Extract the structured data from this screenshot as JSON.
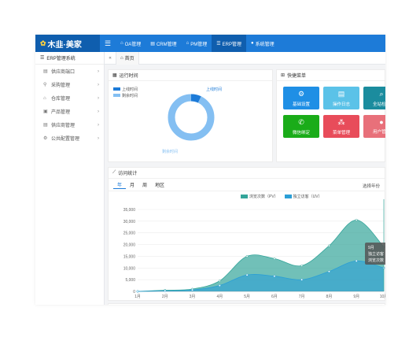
{
  "app": {
    "brand": "木韭·美家",
    "brand_mark": "✿"
  },
  "topnav": {
    "toggle_icon": "menu-icon",
    "items": [
      {
        "label": "OA管理",
        "icon": "home-icon",
        "active": false
      },
      {
        "label": "CRM管理",
        "icon": "doc-icon",
        "active": false
      },
      {
        "label": "PM管理",
        "icon": "building-icon",
        "active": false
      },
      {
        "label": "ERP管理",
        "icon": "list-icon",
        "active": true
      },
      {
        "label": "系统管理",
        "icon": "user-icon",
        "active": false
      }
    ]
  },
  "sidebar": {
    "title": "ERP管理系统",
    "items": [
      {
        "label": "供应商端口",
        "icon": "doc-icon"
      },
      {
        "label": "采购管理",
        "icon": "pin-icon"
      },
      {
        "label": "仓库管理",
        "icon": "warehouse-icon"
      },
      {
        "label": "产品管理",
        "icon": "box-icon"
      },
      {
        "label": "供应商管理",
        "icon": "doc-icon"
      },
      {
        "label": "公共配置管理",
        "icon": "gear-icon"
      }
    ]
  },
  "tabs": {
    "home_label": "首页"
  },
  "runtime": {
    "title": "运行时间",
    "legend": [
      {
        "label": "上线时间",
        "color": "#1d7bd8"
      },
      {
        "label": "剩余时间",
        "color": "#84bff2"
      }
    ],
    "slice_label_online": "上线时间",
    "slice_label_remaining": "剩余时间",
    "online_fraction": 0.07
  },
  "quick_menu": {
    "title": "快捷菜单",
    "buttons": [
      {
        "label": "基础设置",
        "icon": "gear-icon",
        "color": "#1f8fe5"
      },
      {
        "label": "操作日志",
        "icon": "doc-icon",
        "color": "#5bc2e8"
      },
      {
        "label": "全站检索",
        "icon": "search-icon",
        "color": "#1b8c9e"
      },
      {
        "label": "微信绑定",
        "icon": "wechat-icon",
        "color": "#1aac19"
      },
      {
        "label": "菜单管理",
        "icon": "sitemap-icon",
        "color": "#e84c5a"
      },
      {
        "label": "用户管理",
        "icon": "user-icon",
        "color": "#e8707a"
      }
    ]
  },
  "visits": {
    "title": "访问统计",
    "subtabs": [
      "年",
      "月",
      "周",
      "地区"
    ],
    "active_subtab": 0,
    "select_label": "选择年份"
  },
  "chart_data": {
    "type": "area",
    "categories": [
      "1月",
      "2月",
      "3月",
      "4月",
      "5月",
      "6月",
      "7月",
      "8月",
      "9月",
      "10月"
    ],
    "series": [
      {
        "name": "浏览次数（PV）",
        "color": "#34a59a",
        "values": [
          0,
          500,
          1000,
          4500,
          15000,
          14000,
          11000,
          19500,
          30500,
          19000
        ]
      },
      {
        "name": "独立访客（UV）",
        "color": "#2b9fd6",
        "values": [
          0,
          200,
          600,
          2500,
          7000,
          6500,
          5000,
          8500,
          13000,
          10000
        ]
      }
    ],
    "ylim": [
      0,
      35000
    ],
    "yticks": [
      "0",
      "5,000",
      "10,000",
      "15,000",
      "20,000",
      "25,000",
      "30,000",
      "35,000"
    ],
    "tooltip": {
      "title": "9月",
      "lines": [
        "独立访客（UV）: 10,000",
        "浏览次数（PV）: 13,000"
      ]
    }
  }
}
